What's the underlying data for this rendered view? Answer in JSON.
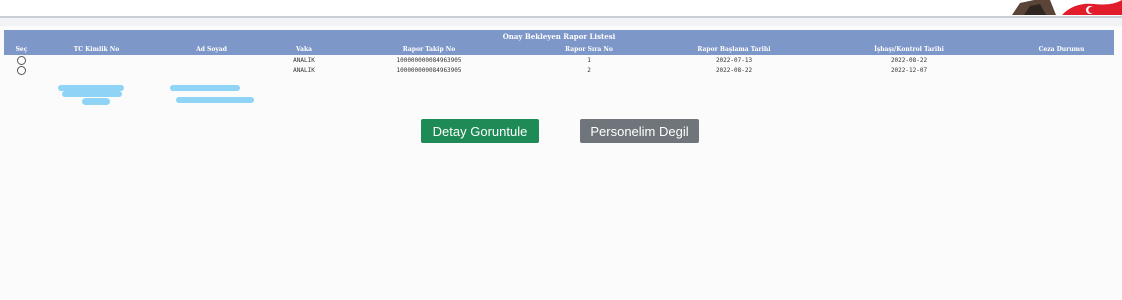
{
  "table": {
    "caption": "Onay Bekleyen Rapor Listesi",
    "columns": [
      "Seç",
      "TC Kimlik No",
      "Ad Soyad",
      "Vaka",
      "Rapor Takip No",
      "Rapor Sıra No",
      "Rapor Başlama Tarihi",
      "İşbaşı/Kontrol Tarihi",
      "Ceza Durumu"
    ],
    "rows": [
      {
        "tc": "",
        "name": "",
        "vaka": "ANALIK",
        "takip_no": "100000000084963905",
        "sira_no": "1",
        "baslama": "2022-07-13",
        "isbasi": "2022-08-22",
        "ceza": ""
      },
      {
        "tc": "",
        "name": "",
        "vaka": "ANALIK",
        "takip_no": "100000000084963905",
        "sira_no": "2",
        "baslama": "2022-08-22",
        "isbasi": "2022-12-07",
        "ceza": ""
      }
    ]
  },
  "buttons": {
    "detail": "Detay Goruntule",
    "not_employee": "Personelim Degil"
  },
  "colors": {
    "header_bg": "#7e97c9",
    "detail_button": "#1e8a56",
    "not_employee_button": "#6f757b",
    "redaction": "#8fd3f7"
  }
}
